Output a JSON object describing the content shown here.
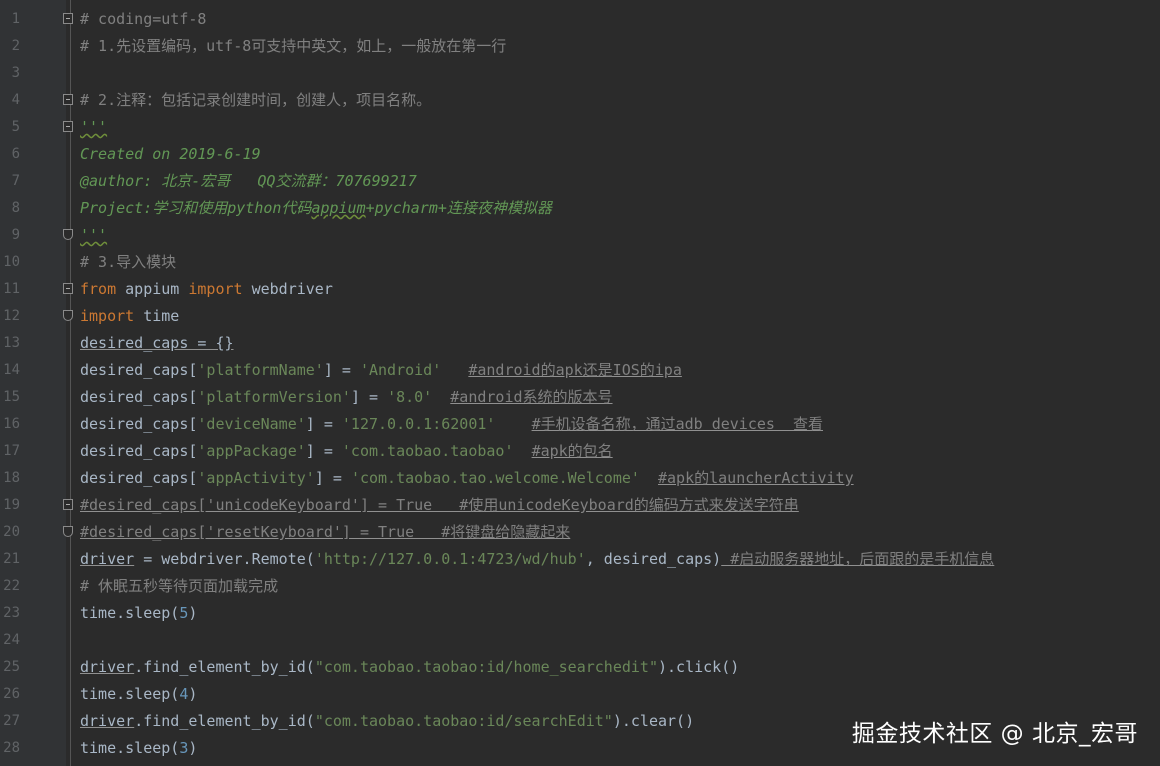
{
  "editor": {
    "lines": [
      {
        "n": "1",
        "fold": "open",
        "tokens": [
          {
            "t": "# coding=utf-8",
            "c": "cmt"
          }
        ]
      },
      {
        "n": "2",
        "tokens": [
          {
            "t": "# 1.先设置编码，utf-8可支持中英文，如上，一般放在第一行",
            "c": "cmt"
          }
        ]
      },
      {
        "n": "3",
        "tokens": []
      },
      {
        "n": "4",
        "fold": "open",
        "tokens": [
          {
            "t": "# 2.注释：包括记录创建时间，创建人，项目名称。",
            "c": "cmt"
          }
        ]
      },
      {
        "n": "5",
        "fold": "open",
        "tokens": [
          {
            "t": "'''",
            "c": "doc",
            "u": "err"
          }
        ]
      },
      {
        "n": "6",
        "tokens": [
          {
            "t": "Created on 2019-6-19",
            "c": "doc"
          }
        ]
      },
      {
        "n": "7",
        "tokens": [
          {
            "t": "@author: 北京-宏哥   QQ交流群：707699217",
            "c": "doc"
          }
        ]
      },
      {
        "n": "8",
        "tokens": [
          {
            "t": "Project:学习和使用python代码",
            "c": "doc"
          },
          {
            "t": "appium",
            "c": "doc",
            "u": "err"
          },
          {
            "t": "+pycharm+连接夜神模拟器",
            "c": "doc"
          }
        ]
      },
      {
        "n": "9",
        "fold": "end",
        "tokens": [
          {
            "t": "'''",
            "c": "doc",
            "u": "err"
          }
        ]
      },
      {
        "n": "10",
        "tokens": [
          {
            "t": "# 3.导入模块",
            "c": "cmt"
          }
        ]
      },
      {
        "n": "11",
        "fold": "open",
        "tokens": [
          {
            "t": "from",
            "c": "kw"
          },
          {
            "t": " appium ",
            "c": "text"
          },
          {
            "t": "import",
            "c": "kw"
          },
          {
            "t": " webdriver",
            "c": "text"
          }
        ]
      },
      {
        "n": "12",
        "fold": "end",
        "tokens": [
          {
            "t": "import",
            "c": "kw"
          },
          {
            "t": " time",
            "c": "text"
          }
        ]
      },
      {
        "n": "13",
        "tokens": [
          {
            "t": "desired_caps = {}",
            "c": "text",
            "u": "ul"
          }
        ]
      },
      {
        "n": "14",
        "tokens": [
          {
            "t": "desired_caps[",
            "c": "text"
          },
          {
            "t": "'platformName'",
            "c": "str"
          },
          {
            "t": "] = ",
            "c": "text"
          },
          {
            "t": "'Android'",
            "c": "str"
          },
          {
            "t": "   ",
            "c": "text"
          },
          {
            "t": "#android的apk还是IOS的ipa",
            "c": "cmt",
            "u": "ul"
          }
        ]
      },
      {
        "n": "15",
        "tokens": [
          {
            "t": "desired_caps[",
            "c": "text"
          },
          {
            "t": "'platformVersion'",
            "c": "str"
          },
          {
            "t": "] = ",
            "c": "text"
          },
          {
            "t": "'8.0'",
            "c": "str"
          },
          {
            "t": "  ",
            "c": "text"
          },
          {
            "t": "#android系统的版本号",
            "c": "cmt",
            "u": "ul"
          }
        ]
      },
      {
        "n": "16",
        "tokens": [
          {
            "t": "desired_caps[",
            "c": "text"
          },
          {
            "t": "'deviceName'",
            "c": "str"
          },
          {
            "t": "] = ",
            "c": "text"
          },
          {
            "t": "'127.0.0.1:62001'",
            "c": "str"
          },
          {
            "t": "    ",
            "c": "text"
          },
          {
            "t": "#手机设备名称，通过adb devices  查看",
            "c": "cmt",
            "u": "ul"
          }
        ]
      },
      {
        "n": "17",
        "tokens": [
          {
            "t": "desired_caps[",
            "c": "text"
          },
          {
            "t": "'appPackage'",
            "c": "str"
          },
          {
            "t": "] = ",
            "c": "text"
          },
          {
            "t": "'com.taobao.taobao'",
            "c": "str"
          },
          {
            "t": "  ",
            "c": "text"
          },
          {
            "t": "#apk的包名",
            "c": "cmt",
            "u": "ul"
          }
        ]
      },
      {
        "n": "18",
        "tokens": [
          {
            "t": "desired_caps[",
            "c": "text"
          },
          {
            "t": "'appActivity'",
            "c": "str"
          },
          {
            "t": "] = ",
            "c": "text"
          },
          {
            "t": "'com.taobao.tao.welcome.Welcome'",
            "c": "str"
          },
          {
            "t": "  ",
            "c": "text"
          },
          {
            "t": "#apk的launcherActivity",
            "c": "cmt",
            "u": "ul"
          }
        ]
      },
      {
        "n": "19",
        "fold": "open",
        "tokens": [
          {
            "t": "#desired_caps['unicodeKeyboard'] = True   #使用unicodeKeyboard的编码方式来发送字符串",
            "c": "cmt",
            "u": "ul"
          }
        ]
      },
      {
        "n": "20",
        "fold": "end",
        "tokens": [
          {
            "t": "#desired_caps['resetKeyboard'] = True   #将键盘给隐藏起来",
            "c": "cmt",
            "u": "ul"
          }
        ]
      },
      {
        "n": "21",
        "tokens": [
          {
            "t": "driver",
            "c": "text",
            "u": "ul"
          },
          {
            "t": " = webdriver.Remote(",
            "c": "text"
          },
          {
            "t": "'http://127.0.0.1:4723/wd/hub'",
            "c": "str"
          },
          {
            "t": ", desired_caps)",
            "c": "text"
          },
          {
            "t": " #启动服务器地址，后面跟的是手机信息",
            "c": "cmt",
            "u": "ul"
          }
        ]
      },
      {
        "n": "22",
        "tokens": [
          {
            "t": "# 休眠五秒等待页面加载完成",
            "c": "cmt"
          }
        ]
      },
      {
        "n": "23",
        "tokens": [
          {
            "t": "time.sleep(",
            "c": "text"
          },
          {
            "t": "5",
            "c": "num"
          },
          {
            "t": ")",
            "c": "text"
          }
        ]
      },
      {
        "n": "24",
        "tokens": []
      },
      {
        "n": "25",
        "tokens": [
          {
            "t": "driver",
            "c": "text",
            "u": "ul"
          },
          {
            "t": ".find_element_by_id(",
            "c": "text"
          },
          {
            "t": "\"com.taobao.taobao:id/home_searchedit\"",
            "c": "str"
          },
          {
            "t": ").click()",
            "c": "text"
          }
        ]
      },
      {
        "n": "26",
        "tokens": [
          {
            "t": "time.sleep(",
            "c": "text"
          },
          {
            "t": "4",
            "c": "num"
          },
          {
            "t": ")",
            "c": "text"
          }
        ]
      },
      {
        "n": "27",
        "tokens": [
          {
            "t": "driver",
            "c": "text",
            "u": "ul"
          },
          {
            "t": ".find_element_by_id(",
            "c": "text"
          },
          {
            "t": "\"com.taobao.taobao:id/searchEdit\"",
            "c": "str"
          },
          {
            "t": ").clear()",
            "c": "text"
          }
        ]
      },
      {
        "n": "28",
        "tokens": [
          {
            "t": "time.sleep(",
            "c": "text"
          },
          {
            "t": "3",
            "c": "num"
          },
          {
            "t": ")",
            "c": "text"
          }
        ]
      }
    ]
  },
  "watermark": "掘金技术社区 @ 北京_宏哥",
  "colors": {
    "background": "#2b2b2b",
    "gutter": "#313335",
    "keyword": "#cc7832",
    "string": "#6a8759",
    "comment": "#808080",
    "docstring": "#629755",
    "number": "#6897bb",
    "text": "#a9b7c6"
  }
}
